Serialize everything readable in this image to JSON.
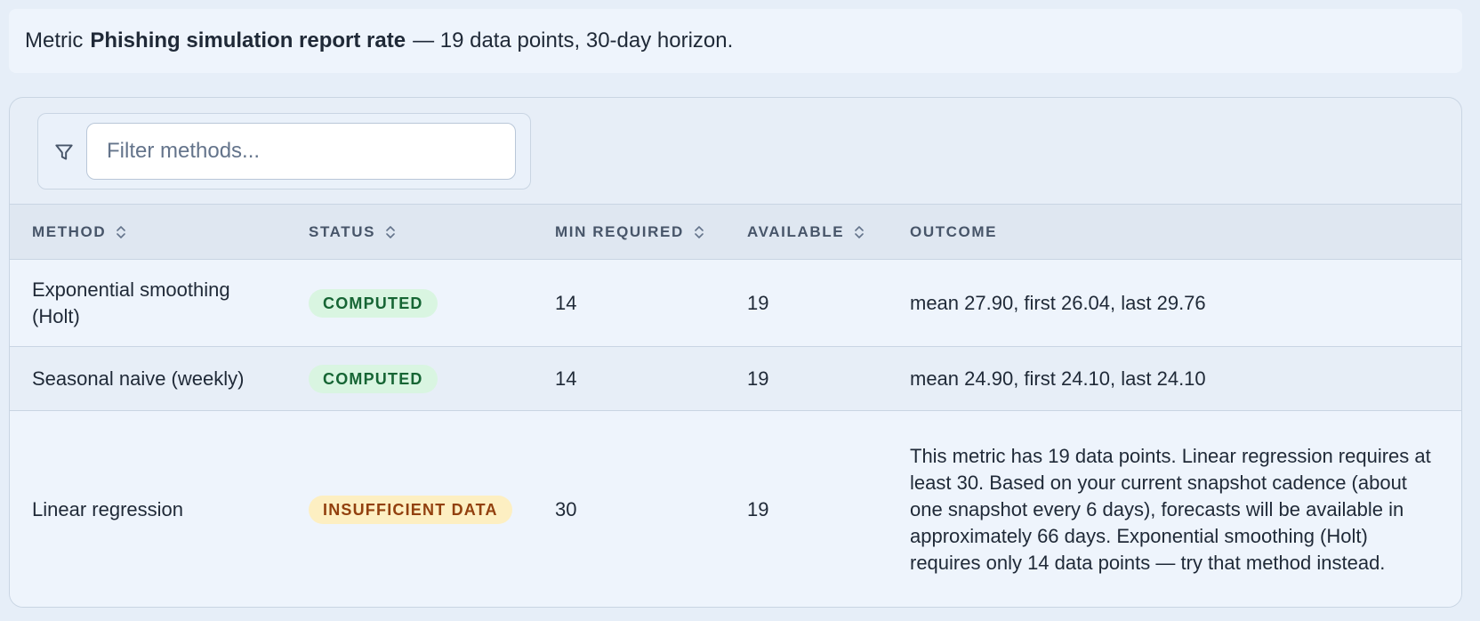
{
  "summary": {
    "prefix": "Metric",
    "metric_name": "Phishing simulation report rate",
    "suffix": "— 19 data points, 30-day horizon."
  },
  "filter": {
    "placeholder": "Filter methods...",
    "value": ""
  },
  "table": {
    "headers": {
      "method": "METHOD",
      "status": "STATUS",
      "min_required": "MIN REQUIRED",
      "available": "AVAILABLE",
      "outcome": "OUTCOME"
    },
    "rows": [
      {
        "method": "Exponential smoothing (Holt)",
        "status": "COMPUTED",
        "min_required": "14",
        "available": "19",
        "outcome": "mean 27.90, first 26.04, last 29.76"
      },
      {
        "method": "Seasonal naive (weekly)",
        "status": "COMPUTED",
        "min_required": "14",
        "available": "19",
        "outcome": "mean 24.90, first 24.10, last 24.10"
      },
      {
        "method": "Linear regression",
        "status": "INSUFFICIENT DATA",
        "min_required": "30",
        "available": "19",
        "outcome": "This metric has 19 data points. Linear regression requires at least 30. Based on your current snapshot cadence (about one snapshot every 6 days), forecasts will be available in approximately 66 days. Exponential smoothing (Holt) requires only 14 data points — try that method instead."
      }
    ]
  },
  "colors": {
    "computed_badge_bg": "#d9f5e1",
    "computed_badge_text": "#166534",
    "insufficient_badge_bg": "#fdefc2",
    "insufficient_badge_text": "#92400e"
  },
  "icons": {
    "filter": "filter-icon",
    "sort": "sort-icon"
  }
}
